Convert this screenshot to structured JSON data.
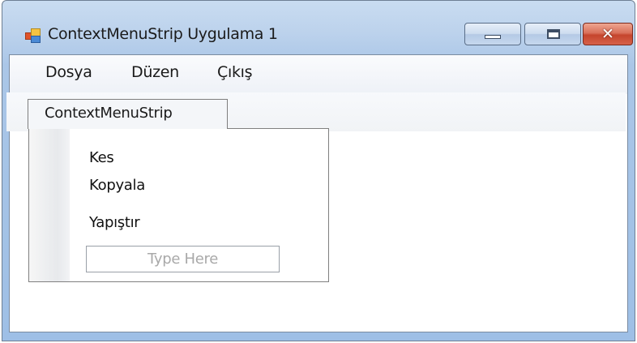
{
  "window": {
    "title": "ContextMenuStrip Uygulama 1",
    "icons": {
      "app": "app-icon",
      "minimize": "minimize-icon",
      "maximize": "maximize-icon",
      "close": "close-icon"
    },
    "close_glyph": "✕"
  },
  "menubar": {
    "items": [
      {
        "label": "Dosya"
      },
      {
        "label": "Düzen"
      },
      {
        "label": "Çıkış"
      }
    ]
  },
  "context_menu_strip": {
    "tab_label": "ContextMenuStrip",
    "items": [
      {
        "label": "Kes"
      },
      {
        "label": "Kopyala"
      },
      {
        "label": "Yapıştır"
      }
    ],
    "new_item_placeholder": "Type Here"
  },
  "colors": {
    "titlebar": "#bcd2ec",
    "close_button": "#c5452d",
    "placeholder_text": "#a9a9a9"
  }
}
